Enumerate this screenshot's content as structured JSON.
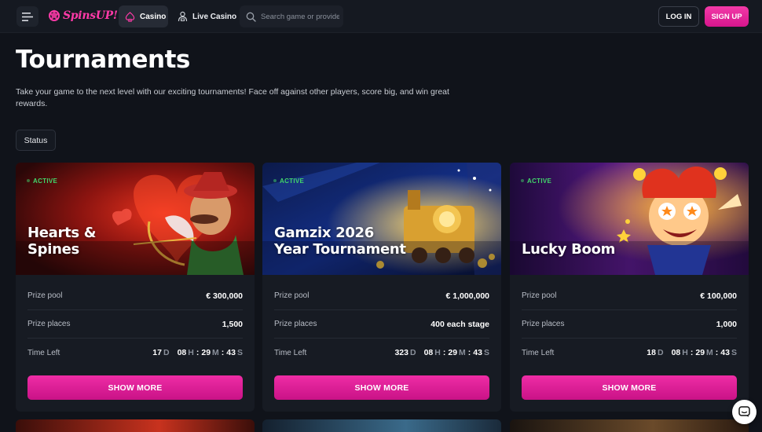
{
  "header": {
    "logo_text": "SpinsUP!",
    "nav": [
      {
        "label": "Casino",
        "icon": "spade-icon",
        "active": true
      },
      {
        "label": "Live Casino",
        "icon": "dealer-icon",
        "active": false
      }
    ],
    "search_placeholder": "Search game or provider",
    "login_label": "LOG IN",
    "signup_label": "SIGN UP"
  },
  "page": {
    "title": "Tournaments",
    "description": "Take your game to the next level with our exciting tournaments! Face off against other players, score big, and win great rewards.",
    "status_filter_label": "Status"
  },
  "labels": {
    "prize_pool": "Prize pool",
    "prize_places": "Prize places",
    "time_left": "Time Left",
    "show_more": "SHOW MORE",
    "unit_d": "D",
    "unit_h": "H",
    "unit_m": "M",
    "unit_s": "S"
  },
  "cards": [
    {
      "status": "ACTIVE",
      "title": "Hearts &\nSpines",
      "prize_pool": "€ 300,000",
      "prize_places": "1,500",
      "days": "17",
      "hours": "08",
      "minutes": "29",
      "seconds": "43"
    },
    {
      "status": "ACTIVE",
      "title": "Gamzix 2026\nYear Tournament",
      "prize_pool": "€ 1,000,000",
      "prize_places": "400 each stage",
      "days": "323",
      "hours": "08",
      "minutes": "29",
      "seconds": "43"
    },
    {
      "status": "ACTIVE",
      "title": "Lucky Boom",
      "prize_pool": "€ 100,000",
      "prize_places": "1,000",
      "days": "18",
      "hours": "08",
      "minutes": "29",
      "seconds": "43"
    }
  ],
  "colors": {
    "accent": "#e8209c",
    "active_green": "#42d66b",
    "background": "#10131a",
    "card": "#171b23"
  }
}
